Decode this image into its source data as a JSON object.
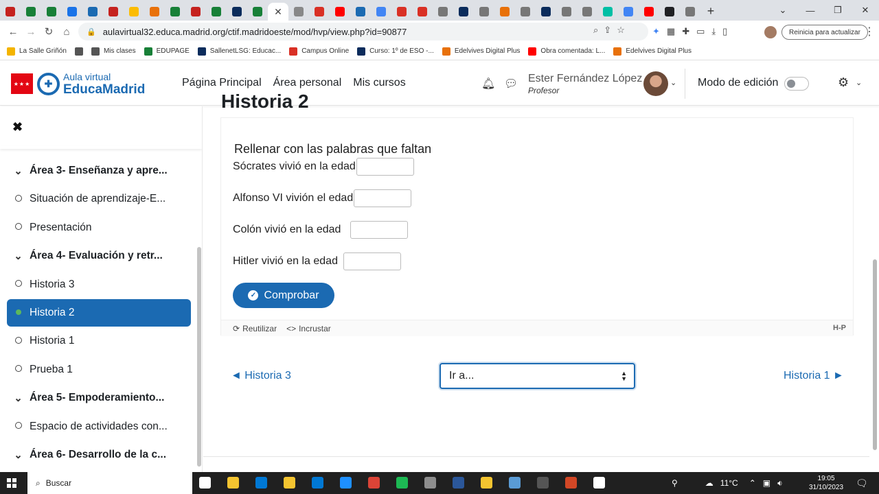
{
  "browser": {
    "tab_favicons": [
      "#c5221f",
      "#188038",
      "#188038",
      "#1a73e8",
      "#1b6ab2",
      "#c5221f",
      "#fbbc04",
      "#e8710a",
      "#188038",
      "#c5221f",
      "#188038",
      "#0b2c5c",
      "#188038"
    ],
    "active_tab_icon": "close-icon",
    "tab_favicons_after": [
      "#888888",
      "#d93025",
      "#ff0000",
      "#1b6ab2",
      "#4285f4",
      "#d93025",
      "#d93025",
      "#777777",
      "#0b2c5c",
      "#777777",
      "#e8710a",
      "#777777",
      "#0b2c5c",
      "#777777",
      "#777777",
      "#00bfa5",
      "#4285f4",
      "#ff0000",
      "#202124",
      "#777777"
    ],
    "url": "aulavirtual32.educa.madrid.org/ctif.madridoeste/mod/hvp/view.php?id=90877",
    "update_label": "Reinicia para actualizar"
  },
  "bookmarks": [
    {
      "label": "La Salle Griñón",
      "color": "#f4b400"
    },
    {
      "label": "",
      "color": "#555555"
    },
    {
      "label": "Mis clases",
      "color": "#555555"
    },
    {
      "label": "EDUPAGE",
      "color": "#188038"
    },
    {
      "label": "SallenetLSG: Educac...",
      "color": "#0b2c5c"
    },
    {
      "label": "Campus Online",
      "color": "#d93025"
    },
    {
      "label": "Curso: 1º de ESO -...",
      "color": "#0b2c5c"
    },
    {
      "label": "Edelvives Digital Plus",
      "color": "#e8710a"
    },
    {
      "label": "Obra comentada: L...",
      "color": "#ff0000"
    },
    {
      "label": "Edelvives Digital Plus",
      "color": "#e8710a"
    }
  ],
  "header": {
    "logo_top": "Aula virtual",
    "logo_bottom": "EducaMadrid",
    "nav": [
      "Página Principal",
      "Área personal",
      "Mis cursos"
    ],
    "user_name": "Ester Fernández López",
    "user_role": "Profesor",
    "edit_mode_label": "Modo de edición"
  },
  "course_index": [
    {
      "label": "Área 3- Enseñanza y apre...",
      "type": "section"
    },
    {
      "label": "Situación de aprendizaje-E...",
      "type": "item"
    },
    {
      "label": "Presentación",
      "type": "item"
    },
    {
      "label": "Área 4- Evaluación y retr...",
      "type": "section"
    },
    {
      "label": "Historia 3",
      "type": "item"
    },
    {
      "label": "Historia 2",
      "type": "active"
    },
    {
      "label": "Historia 1",
      "type": "item"
    },
    {
      "label": "Prueba 1",
      "type": "item"
    },
    {
      "label": "Área 5- Empoderamiento...",
      "type": "section"
    },
    {
      "label": "Espacio de actividades con...",
      "type": "item"
    },
    {
      "label": "Área 6- Desarrollo de la c...",
      "type": "section"
    }
  ],
  "content": {
    "page_title": "Historia 2",
    "h5p_title": "Rellenar con las palabras que faltan",
    "blanks": [
      {
        "text": "Sócrates vivió en la edad",
        "value": ""
      },
      {
        "text": "Alfonso VI vivión el edad",
        "value": ""
      },
      {
        "text": "Colón vivió en la edad ",
        "value": ""
      },
      {
        "text": "Hitler vivió en la edad ",
        "value": ""
      }
    ],
    "check_label": "Comprobar",
    "reuse_label": "Reutilizar",
    "embed_label": "Incrustar",
    "h5p_logo": "H-P",
    "prev_label": "◄ Historia 3",
    "next_label": "Historia 1 ►",
    "jump_label": "Ir a..."
  },
  "taskbar": {
    "search_label": "Buscar",
    "icon_colors": [
      "#ffffff",
      "#f4c430",
      "#0078d4",
      "#f4c430",
      "#0078d4",
      "#1e90ff",
      "#db4437",
      "#1db954",
      "#8e8e8e",
      "#2b579a",
      "#f4c430",
      "#5a9bd5",
      "#555555",
      "#d24726",
      "#ffffff"
    ],
    "temperature": "11°C",
    "time": "19:05",
    "date": "31/10/2023"
  }
}
